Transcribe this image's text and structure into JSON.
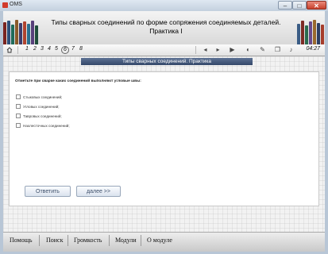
{
  "window": {
    "title": "OMS",
    "min": "–",
    "max": "□",
    "close": "✕"
  },
  "header": {
    "title_line1": "Типы сварных соединений по форме сопряжения соединяемых деталей.",
    "title_line2": "Практика I"
  },
  "toolbar": {
    "pages": [
      "1",
      "2",
      "3",
      "4",
      "5",
      "6",
      "7",
      "8"
    ],
    "active_page": "6",
    "time": "04:27",
    "icons": [
      "home-icon",
      "back-icon",
      "forward-icon",
      "play-icon",
      "volume-icon",
      "tools-icon",
      "pages-icon",
      "sound-icon"
    ]
  },
  "section": {
    "title": "Типы сварных соединений. Практика"
  },
  "quiz": {
    "question": "Отметьте при сварке каких соединений выполняют угловые швы:",
    "options": [
      "Стыковых соединений;",
      "Угловых соединений;",
      "Тавровых соединений;",
      "Нахлесточных соединений;"
    ]
  },
  "buttons": {
    "answer": "Ответить",
    "next": "далее >>"
  },
  "menu": [
    "Помощь",
    "Поиск",
    "Громкость",
    "Модули",
    "О модуле"
  ],
  "colors": {
    "section_bar": "#3f5577",
    "close_button": "#c8412c"
  }
}
